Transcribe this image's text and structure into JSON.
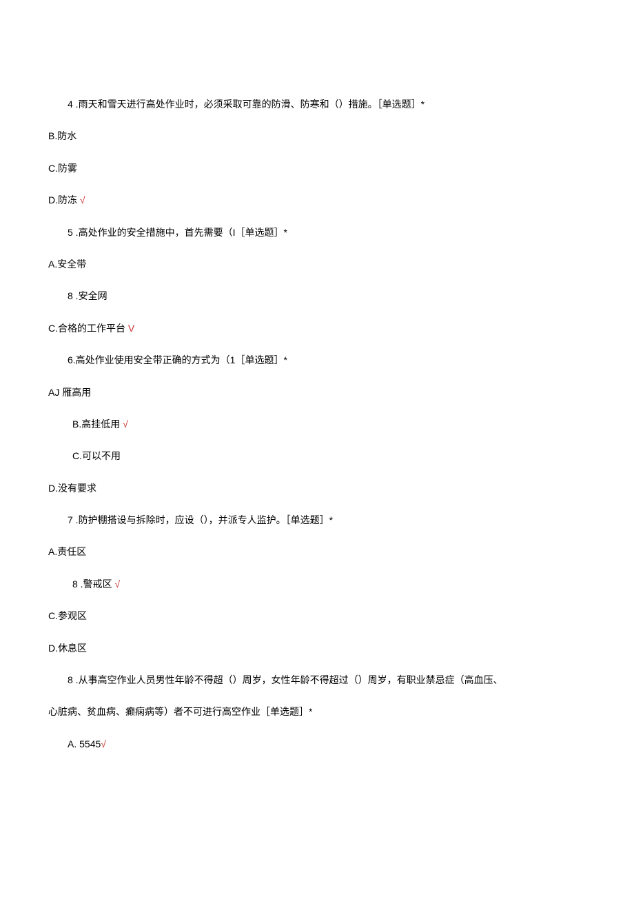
{
  "q4": {
    "text": "4 .雨天和雪天进行高处作业时，必须采取可靠的防滑、防寒和（）措施。［单选题］*",
    "options": {
      "b": "B.防水",
      "c": "C.防雾",
      "d": "D.防冻 "
    },
    "correct_mark": "√"
  },
  "q5": {
    "text": "5 .高处作业的安全措施中，首先需要（I［单选题］*",
    "options": {
      "a": "A.安全带",
      "b": "8 .安全网",
      "c": "C.合格的工作平台 "
    },
    "correct_mark": "V"
  },
  "q6": {
    "text": "6.高处作业使用安全带正确的方式为（1［单选题］*",
    "options": {
      "a": "AJ 雁高用",
      "b": "B.高挂低用 ",
      "c": "C.可以不用",
      "d": "D.没有要求"
    },
    "correct_mark": "√"
  },
  "q7": {
    "text": "7 .防护棚搭设与拆除时，应设（），并派专人监护。［单选题］*",
    "options": {
      "a": "A.责任区",
      "b": "8 .警戒区 ",
      "c": "C.参观区",
      "d": "D.休息区"
    },
    "correct_mark": "√"
  },
  "q8": {
    "text_line1": "8 .从事高空作业人员男性年龄不得超（）周岁，女性年龄不得超过（）周岁，有职业禁忌症（高血压、",
    "text_line2": "心脏病、贫血病、癫痫病等）者不可进行高空作业［单选题］*",
    "options": {
      "a": "A.   5545"
    },
    "correct_mark": "√"
  }
}
